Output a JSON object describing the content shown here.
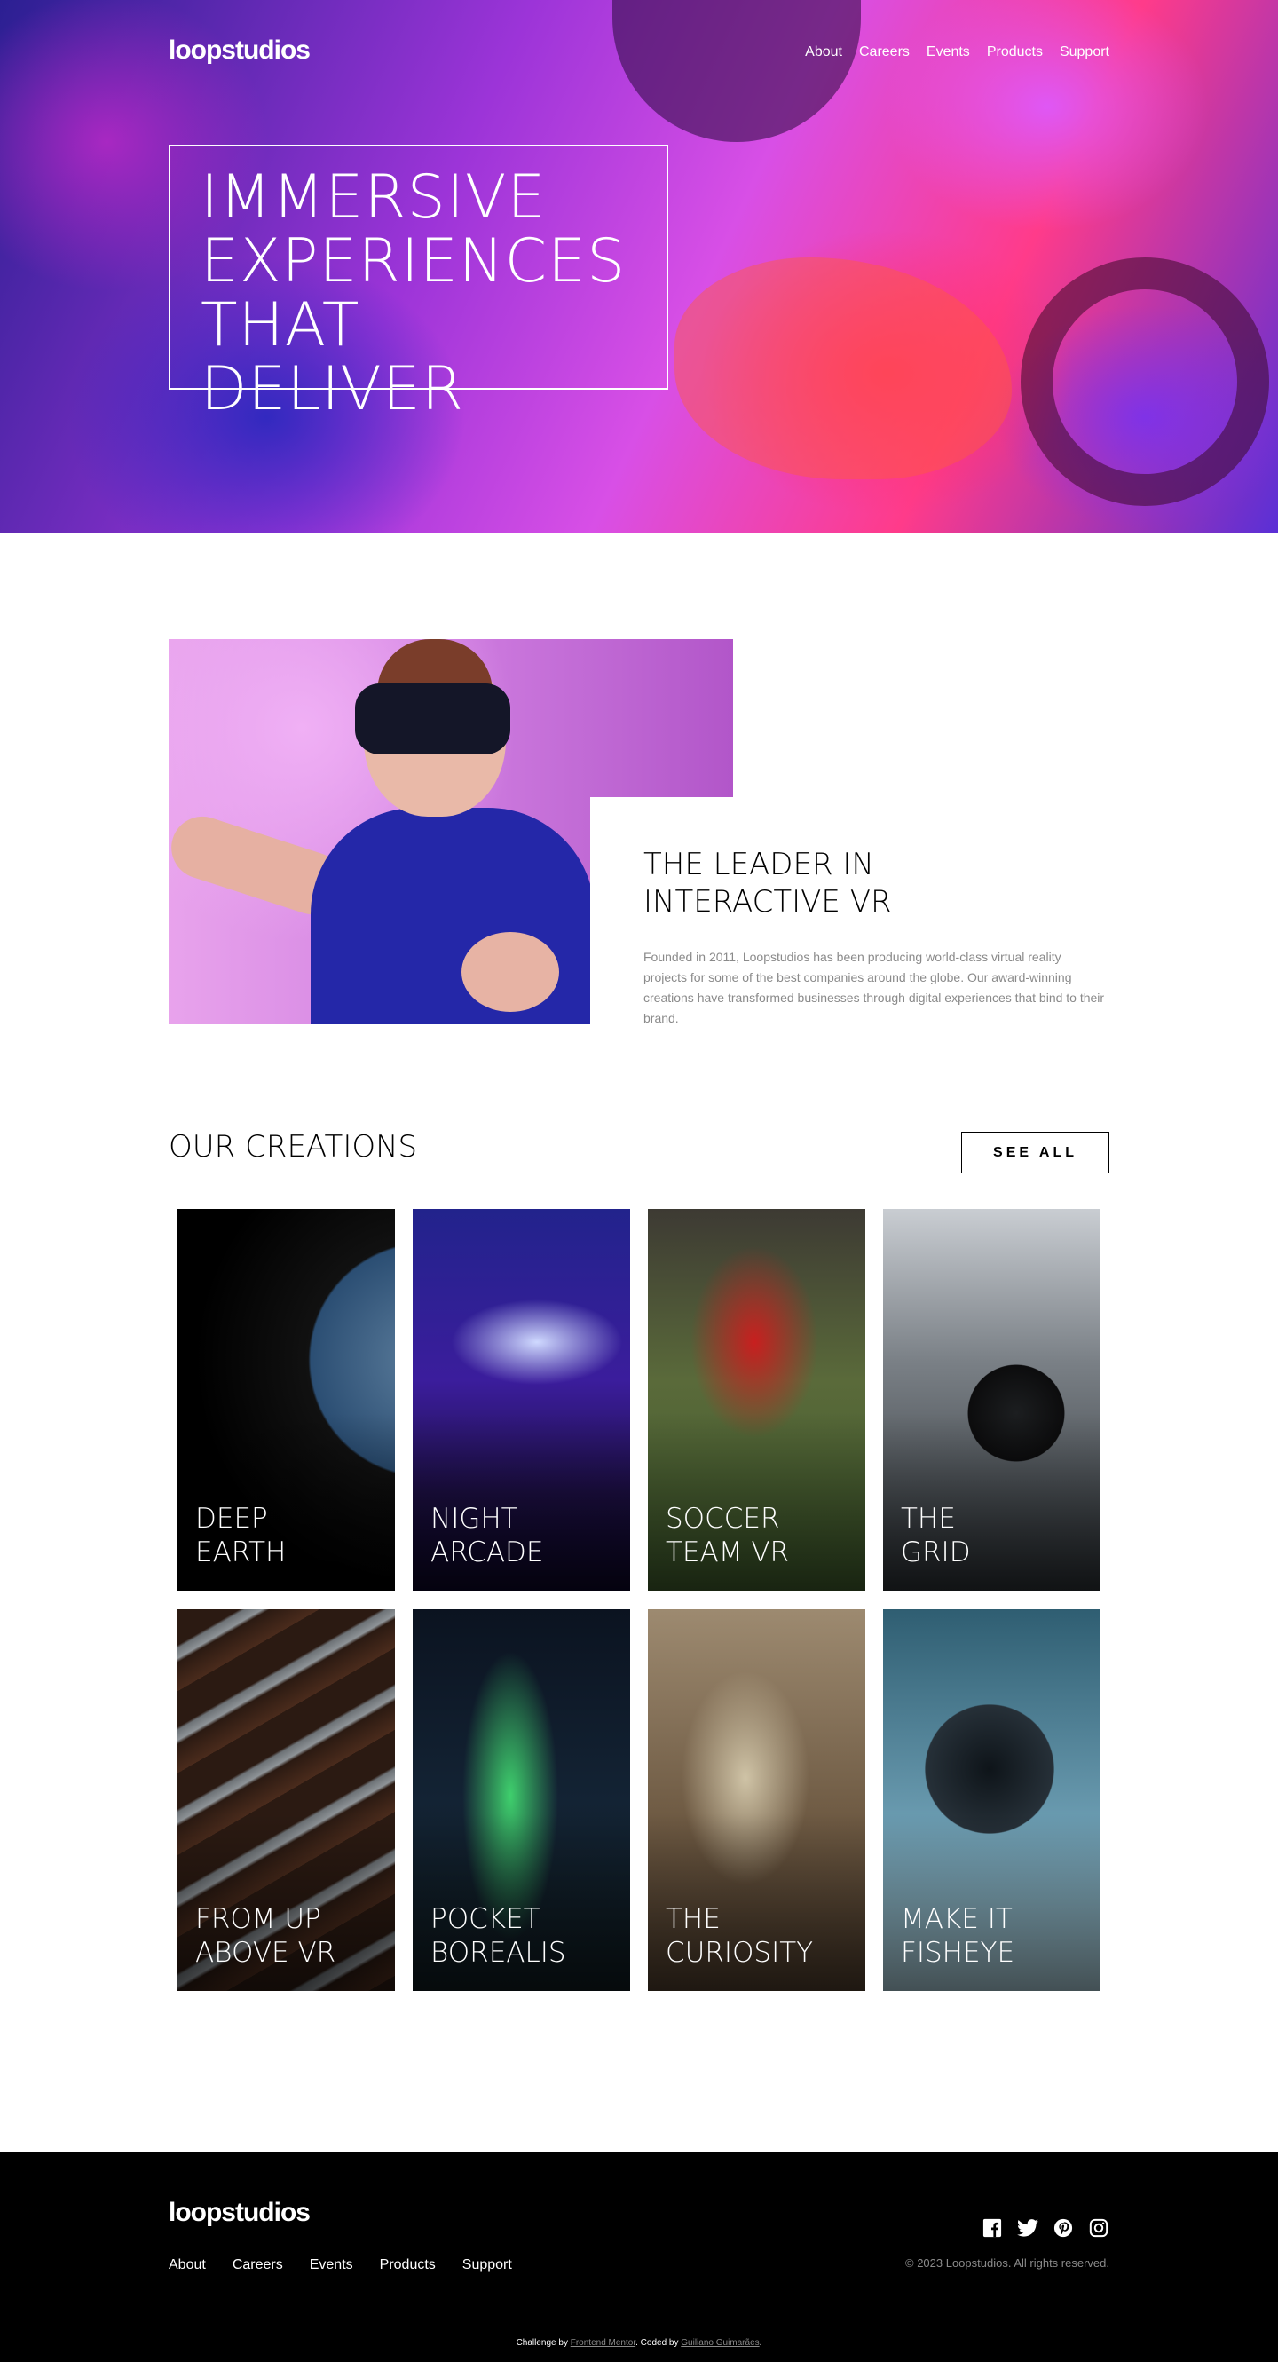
{
  "brand": {
    "logo": "loopstudios"
  },
  "nav": [
    {
      "label": "About"
    },
    {
      "label": "Careers"
    },
    {
      "label": "Events"
    },
    {
      "label": "Products"
    },
    {
      "label": "Support"
    }
  ],
  "hero": {
    "title_lines": [
      "IMMERSIVE",
      "EXPERIENCES",
      "THAT DELIVER"
    ]
  },
  "about": {
    "title_lines": [
      "THE LEADER IN",
      "INTERACTIVE VR"
    ],
    "body": "Founded in 2011, Loopstudios has been producing world-class virtual reality projects for some of the best companies around the globe. Our award-winning creations have transformed businesses through digital experiences that bind to their brand."
  },
  "creations": {
    "title": "OUR CREATIONS",
    "see_all": "SEE ALL",
    "items": [
      {
        "lines": [
          "DEEP",
          "EARTH"
        ]
      },
      {
        "lines": [
          "NIGHT",
          "ARCADE"
        ]
      },
      {
        "lines": [
          "SOCCER",
          "TEAM VR"
        ]
      },
      {
        "lines": [
          "THE",
          "GRID"
        ]
      },
      {
        "lines": [
          "FROM UP",
          "ABOVE VR"
        ]
      },
      {
        "lines": [
          "POCKET",
          "BOREALIS"
        ]
      },
      {
        "lines": [
          "THE",
          "CURIOSITY"
        ]
      },
      {
        "lines": [
          "MAKE IT",
          "FISHEYE"
        ]
      }
    ]
  },
  "footer": {
    "logo": "loopstudios",
    "nav": [
      {
        "label": "About"
      },
      {
        "label": "Careers"
      },
      {
        "label": "Events"
      },
      {
        "label": "Products"
      },
      {
        "label": "Support"
      }
    ],
    "socials": [
      "facebook-icon",
      "twitter-icon",
      "pinterest-icon",
      "instagram-icon"
    ],
    "copyright": "© 2023 Loopstudios. All rights reserved.",
    "attribution": {
      "prefix": "Challenge by",
      "challenge_by": "Frontend Mentor",
      "mid": ". Coded by",
      "coded_by": "Guiliano Guimarães",
      "suffix": "."
    }
  }
}
